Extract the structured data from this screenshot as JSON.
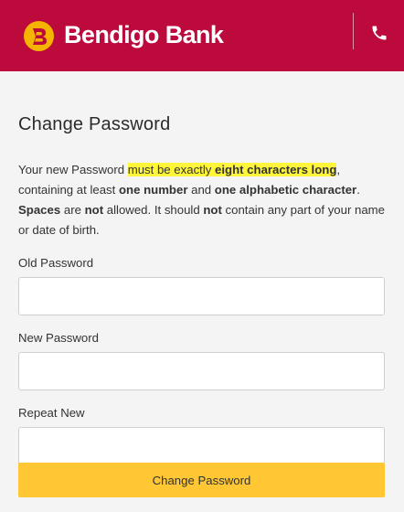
{
  "header": {
    "brand": "Bendigo Bank",
    "logo_icon": "bendigo-logo-icon",
    "phone_icon": "phone-icon",
    "background": "#bc0a3c",
    "logo_color": "#f5b400"
  },
  "form": {
    "title": "Change Password",
    "instructions": {
      "t1": "Your new Password ",
      "h1": "must be exactly ",
      "h2": "eight characters long",
      "t2": ", containing at least ",
      "b1": "one number",
      "t3": " and ",
      "b2": "one alphabetic character",
      "t4": ". ",
      "b3": "Spaces",
      "t5": " are ",
      "b4": "not",
      "t6": " allowed. It should ",
      "b5": "not",
      "t7": " contain any part of your name or date of birth."
    },
    "fields": [
      {
        "label": "Old Password",
        "value": ""
      },
      {
        "label": "New Password",
        "value": ""
      },
      {
        "label": "Repeat New",
        "value": ""
      }
    ],
    "submit_label": "Change Password",
    "submit_color": "#ffc733"
  }
}
